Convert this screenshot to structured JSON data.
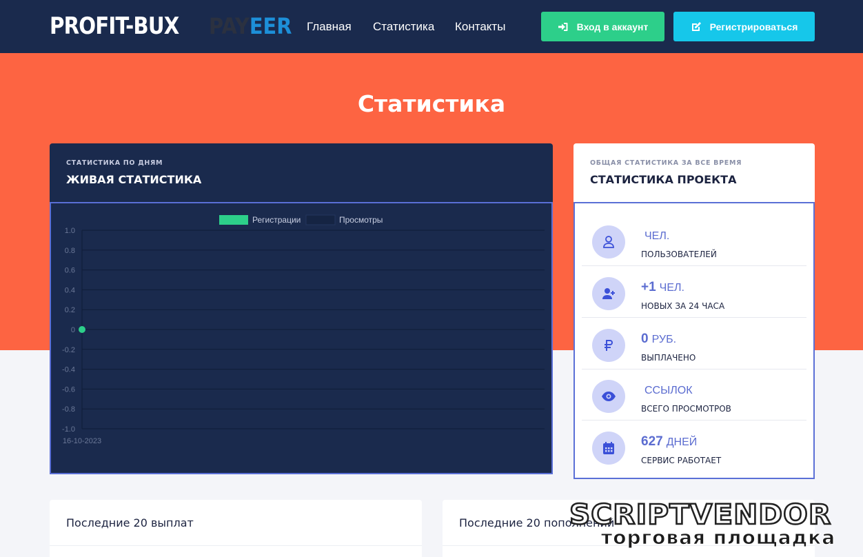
{
  "header": {
    "logo": "PROFIT-BUX",
    "payeer_a": "PAY",
    "payeer_b": "EER",
    "nav": [
      "Главная",
      "Статистика",
      "Контакты"
    ],
    "login_label": "Вход в аккаунт",
    "register_label": "Регистрироваться"
  },
  "hero": {
    "title": "Статистика"
  },
  "live": {
    "kicker": "СТАТИСТИКА ПО ДНЯМ",
    "title": "ЖИВАЯ СТАТИСТИКА"
  },
  "chart_data": {
    "type": "line",
    "series": [
      {
        "name": "Регистрации",
        "color": "#2dcf8a",
        "points": [
          {
            "x": "16-10-2023",
            "y": 0
          }
        ]
      },
      {
        "name": "Просмотры",
        "color": "#152443",
        "points": []
      }
    ],
    "x_ticks": [
      "16-10-2023"
    ],
    "y_ticks": [
      "1.0",
      "0.8",
      "0.6",
      "0.4",
      "0.2",
      "0",
      "-0.2",
      "-0.4",
      "-0.6",
      "-0.8",
      "-1.0"
    ],
    "ylim": [
      -1.0,
      1.0
    ],
    "grid": true,
    "legend": "top-center"
  },
  "stats": {
    "kicker": "ОБЩАЯ СТАТИСТИКА ЗА ВСЕ ВРЕМЯ",
    "title": "СТАТИСТИКА ПРОЕКТА",
    "rows": [
      {
        "icon": "user-icon",
        "value": "",
        "unit": "ЧЕЛ.",
        "label": "ПОЛЬЗОВАТЕЛЕЙ"
      },
      {
        "icon": "user-plus-icon",
        "value": "+1",
        "unit": "ЧЕЛ.",
        "label": "НОВЫХ ЗА 24 ЧАСА"
      },
      {
        "icon": "ruble-icon",
        "value": "0",
        "unit": "РУБ.",
        "label": "ВЫПЛАЧЕНО"
      },
      {
        "icon": "eye-icon",
        "value": "",
        "unit": "ССЫЛОК",
        "label": "ВСЕГО ПРОСМОТРОВ"
      },
      {
        "icon": "calendar-icon",
        "value": "627",
        "unit": "ДНЕЙ",
        "label": "СЕРВИС РАБОТАЕТ"
      }
    ]
  },
  "bottom": {
    "payouts_title": "Последние 20 выплат",
    "deposits_title": "Последние 20 пополнений"
  },
  "watermark": {
    "line1": "SCRIPTVENDOR",
    "line2": "торговая площадка"
  },
  "colors": {
    "navy": "#1a2a4d",
    "orange": "#fd6442",
    "green": "#2dcf8a",
    "cyan": "#16c7ea",
    "accent": "#5b6cd0"
  }
}
